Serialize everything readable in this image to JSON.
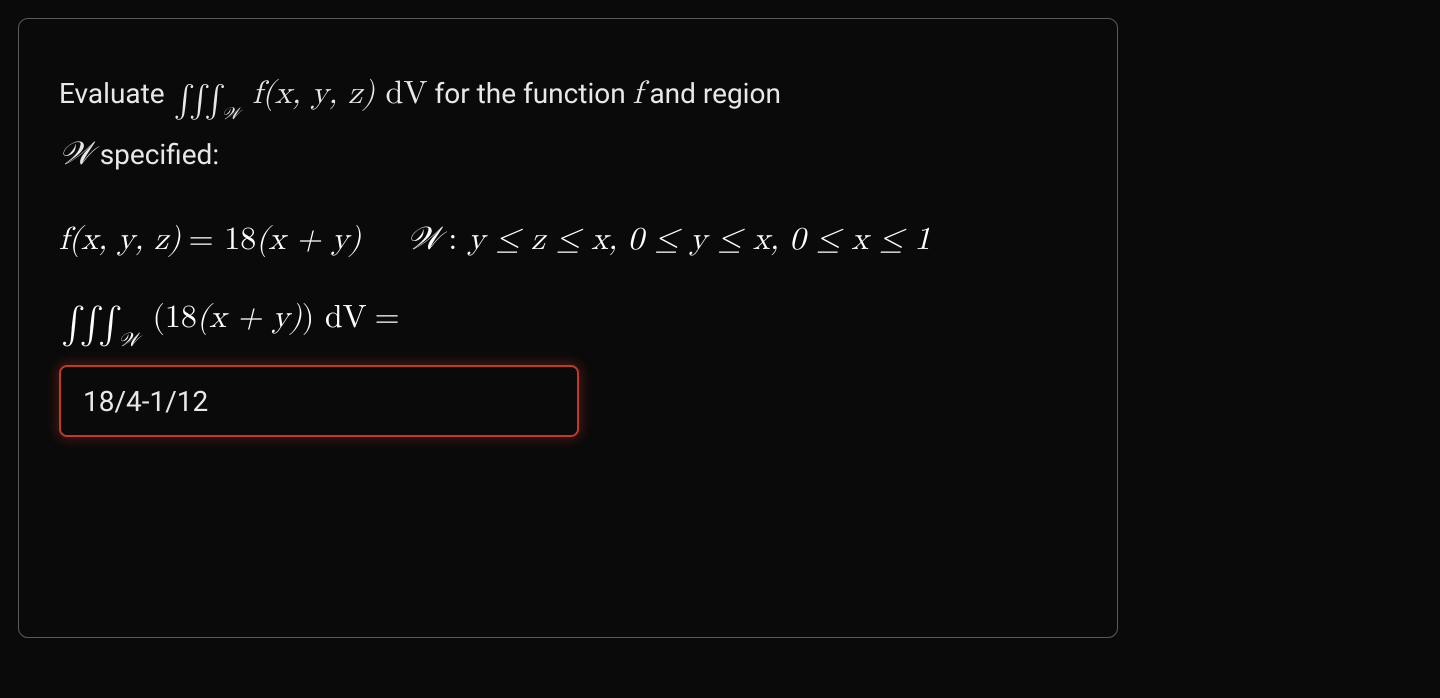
{
  "problem": {
    "prefix": "Evaluate ",
    "integral_symbols": "∫∫∫",
    "region_sub": "𝒲",
    "fcall": "f(x, y, z) ",
    "dV": "dV",
    "mid": " for the function ",
    "fsym": "f",
    "mid2": " and region ",
    "region_name": "𝒲",
    "suffix": " specified:"
  },
  "definition": {
    "func_lhs": "f(x, y, z)",
    "eq": " = ",
    "func_rhs_coef": "18",
    "func_rhs_paren": "(x + y)",
    "region_label": "𝒲",
    "colon": " : ",
    "bounds": "y ≤ z ≤ x, 0 ≤ y ≤ x, 0 ≤ x ≤ 1"
  },
  "question": {
    "integral_symbols": "∫∫∫",
    "sub": "𝒲",
    "open": "(",
    "coef": "18",
    "inner": "(x + y)",
    "close": ") ",
    "dV": "dV",
    "eq": " ="
  },
  "answer": {
    "value": "18/4-1/12"
  }
}
